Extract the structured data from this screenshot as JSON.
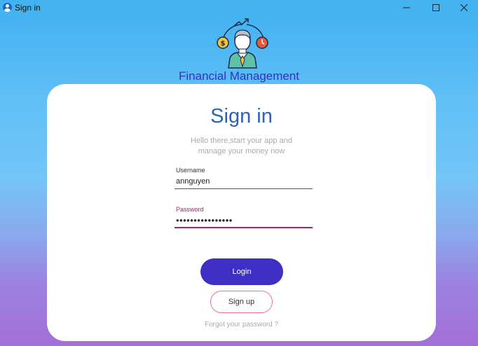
{
  "window": {
    "title": "Sign in",
    "icon": "user-circle-icon",
    "controls": [
      "minimize-icon",
      "maximize-icon",
      "close-icon"
    ]
  },
  "brand": {
    "logo_icon": "financial-manager-icon",
    "title": "Financial Management"
  },
  "signin": {
    "heading": "Sign in",
    "subtitle_line1": "Hello there,start your app and",
    "subtitle_line2": "manage your money now",
    "username_label": "Username",
    "username_value": "annguyen",
    "password_label": "Password",
    "password_value": "••••••••••••••••",
    "login_label": "Login",
    "signup_label": "Sign up",
    "forgot_label": "Forgot your password ?"
  },
  "colors": {
    "accent": "#3f2fc5",
    "heading": "#2c63b5",
    "password_focus": "#a0246e",
    "signup_border": "#ef6e9c"
  }
}
